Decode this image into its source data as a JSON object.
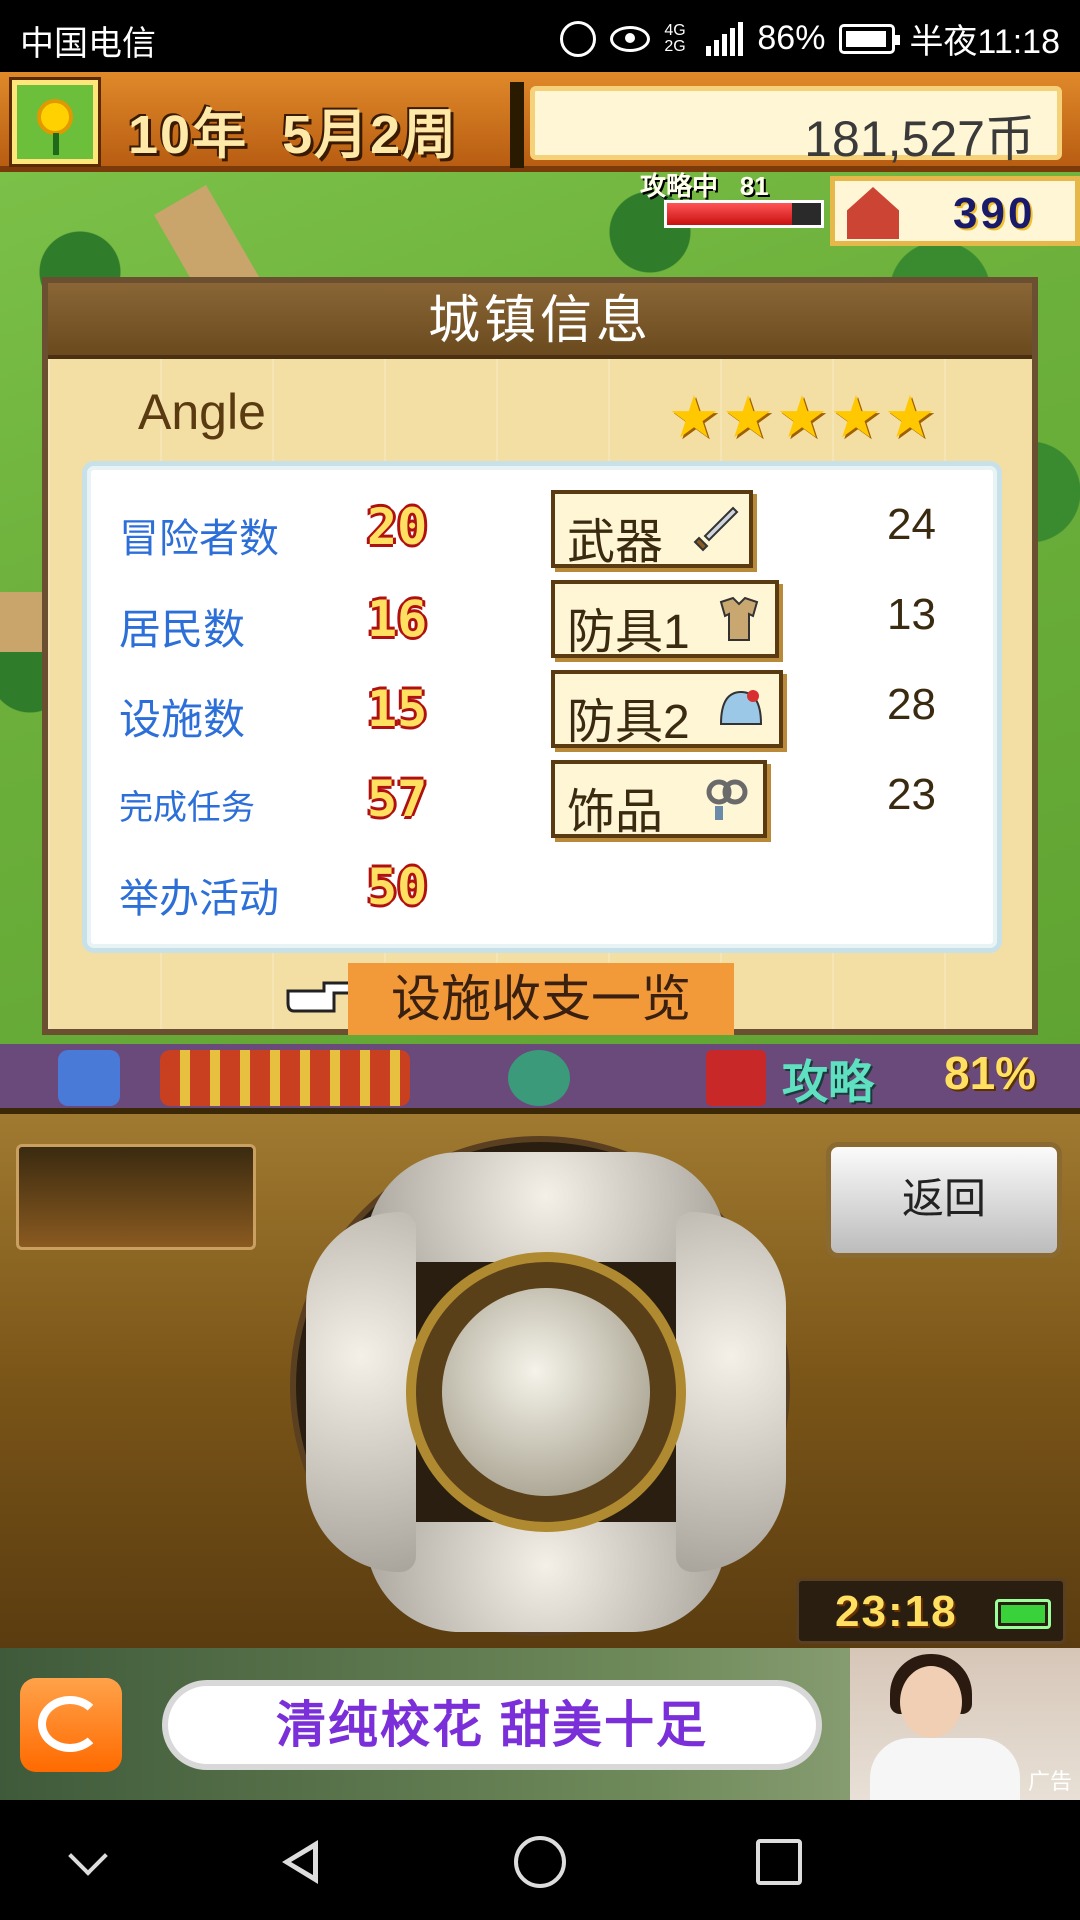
{
  "status_bar": {
    "carrier": "中国电信",
    "network": "4G 2G",
    "battery_percent": "86%",
    "time": "半夜11:18"
  },
  "top_bar": {
    "year": "10年",
    "month": "5月2周",
    "money": "181,527币"
  },
  "siege_progress": {
    "label": "攻略中",
    "value_text": "81",
    "fill_fraction": 0.81
  },
  "population": {
    "value": "390"
  },
  "dialog": {
    "title": "城镇信息",
    "town_name": "Angle",
    "stars": "★★★★★",
    "star_count": 5,
    "stats": [
      {
        "label": "冒险者数",
        "value": "20"
      },
      {
        "label": "居民数",
        "value": "16"
      },
      {
        "label": "设施数",
        "value": "15"
      },
      {
        "label": "完成任务",
        "value": "57"
      },
      {
        "label": "举办活动",
        "value": "50"
      }
    ],
    "equipment": [
      {
        "label": "武器",
        "count": "24",
        "icon": "sword-icon"
      },
      {
        "label": "防具1",
        "count": "13",
        "icon": "armor-icon"
      },
      {
        "label": "防具2",
        "count": "28",
        "icon": "helmet-icon"
      },
      {
        "label": "饰品",
        "count": "23",
        "icon": "accessory-icon"
      }
    ],
    "facility_link": "设施收支一览"
  },
  "bottom_strip": {
    "siege_label": "攻略",
    "siege_value": "81%"
  },
  "controller": {
    "back_label": "返回",
    "clock": "23:18"
  },
  "ad": {
    "text": "清纯校花  甜美十足",
    "tag": "广告"
  },
  "colors": {
    "stat_label": "#2d6fd8",
    "facility_button": "#f29a3a",
    "dialog_bg": "#f3dfa4",
    "header_bg": "#6a4a1e"
  }
}
